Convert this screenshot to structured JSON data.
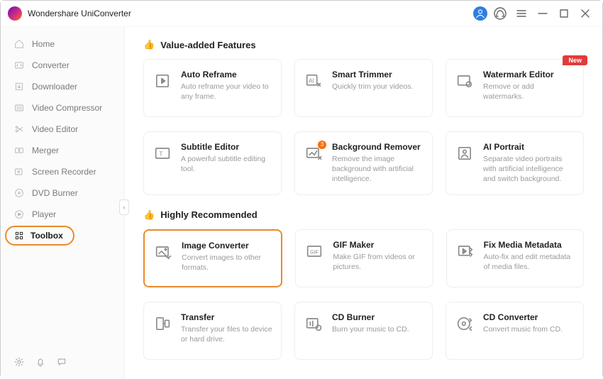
{
  "title": "Wondershare UniConverter",
  "sidebar": {
    "items": [
      {
        "label": "Home",
        "icon": "home-icon"
      },
      {
        "label": "Converter",
        "icon": "converter-icon"
      },
      {
        "label": "Downloader",
        "icon": "download-icon"
      },
      {
        "label": "Video Compressor",
        "icon": "compress-icon"
      },
      {
        "label": "Video Editor",
        "icon": "scissors-icon"
      },
      {
        "label": "Merger",
        "icon": "merge-icon"
      },
      {
        "label": "Screen Recorder",
        "icon": "record-icon"
      },
      {
        "label": "DVD Burner",
        "icon": "disc-icon"
      },
      {
        "label": "Player",
        "icon": "play-icon"
      },
      {
        "label": "Toolbox",
        "icon": "grid-icon"
      }
    ],
    "active_index": 9
  },
  "sections": [
    {
      "title": "Value-added Features",
      "cards": [
        {
          "title": "Auto Reframe",
          "desc": "Auto reframe your video to any frame.",
          "icon": "reframe-icon"
        },
        {
          "title": "Smart Trimmer",
          "desc": "Quickly trim your videos.",
          "icon": "trim-icon"
        },
        {
          "title": "Watermark Editor",
          "desc": "Remove or add watermarks.",
          "icon": "watermark-icon",
          "badge": "New"
        }
      ]
    },
    {
      "title": "",
      "cards": [
        {
          "title": "Subtitle Editor",
          "desc": "A powerful subtitle editing tool.",
          "icon": "subtitle-icon"
        },
        {
          "title": "Background Remover",
          "desc": "Remove the image background with artificial intelligence.",
          "icon": "bgremove-icon",
          "dot": "3"
        },
        {
          "title": "AI Portrait",
          "desc": "Separate video portraits with artificial intelligence and switch background.",
          "icon": "portrait-icon"
        }
      ]
    },
    {
      "title": "Highly Recommended",
      "cards": [
        {
          "title": "Image Converter",
          "desc": "Convert images to other formats.",
          "icon": "imgconv-icon",
          "highlight": true
        },
        {
          "title": "GIF Maker",
          "desc": "Make GIF from videos or pictures.",
          "icon": "gif-icon"
        },
        {
          "title": "Fix Media Metadata",
          "desc": "Auto-fix and edit metadata of media files.",
          "icon": "metadata-icon"
        }
      ]
    },
    {
      "title": "",
      "cards": [
        {
          "title": "Transfer",
          "desc": "Transfer your files to device or hard drive.",
          "icon": "transfer-icon"
        },
        {
          "title": "CD Burner",
          "desc": "Burn your music to CD.",
          "icon": "cdburn-icon"
        },
        {
          "title": "CD Converter",
          "desc": "Convert music from CD.",
          "icon": "cdconv-icon"
        }
      ]
    }
  ]
}
